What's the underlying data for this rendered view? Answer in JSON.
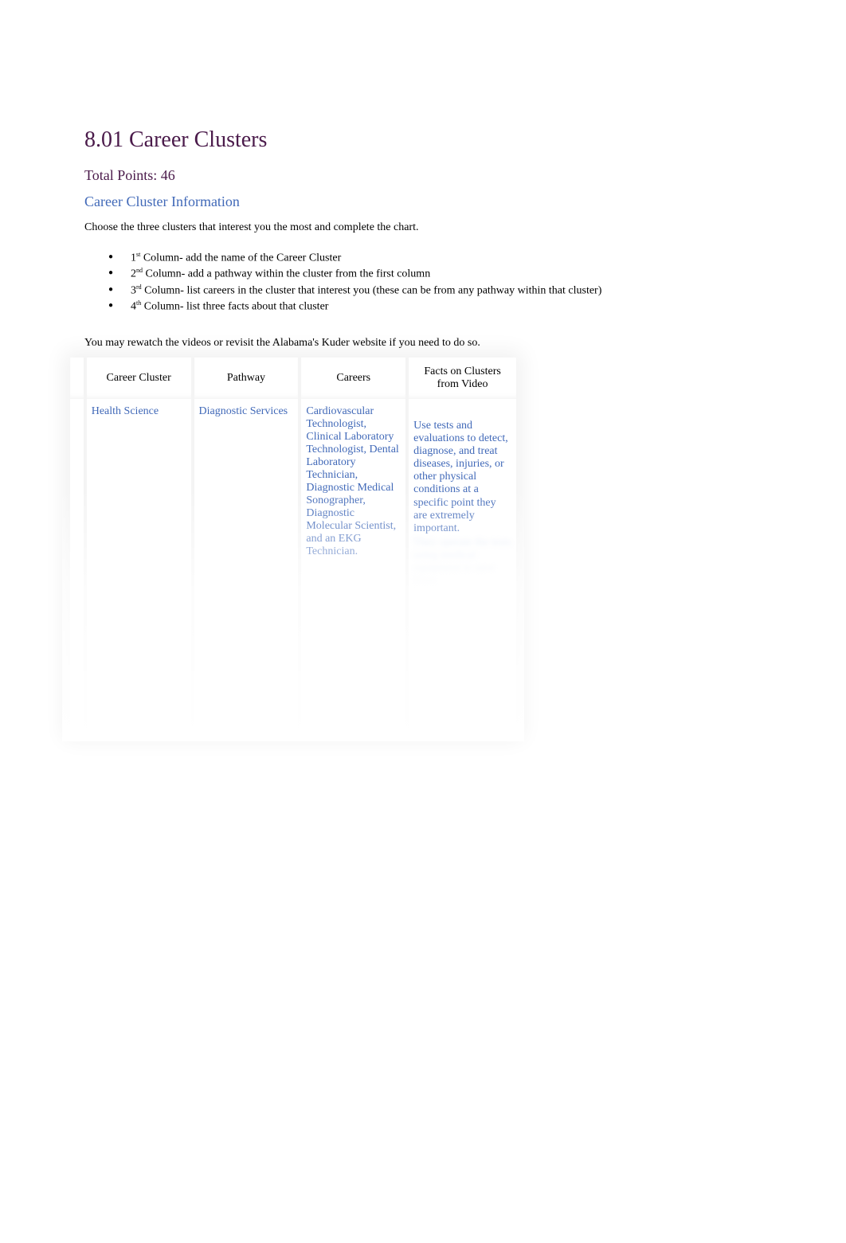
{
  "title": "8.01 Career Clusters",
  "total_points": "Total Points: 46",
  "section_heading": "Career Cluster Information",
  "instruction": "Choose the three clusters that interest you the most and complete the chart.",
  "bullets": {
    "b1_prefix": "1",
    "b1_sup": "st",
    "b1_text": " Column- add the name of the Career Cluster",
    "b2_prefix": "2",
    "b2_sup": "nd",
    "b2_text": " Column- add a pathway within the cluster from the first column",
    "b3_prefix": "3",
    "b3_sup": "rd",
    "b3_text": " Column- list careers in the cluster that interest you (these can be from any pathway within that cluster)",
    "b4_prefix": "4",
    "b4_sup": "th",
    "b4_text": " Column- list three facts about that cluster"
  },
  "note": "You may rewatch the videos or revisit the Alabama's Kuder website if you need to do so.",
  "table": {
    "headers": {
      "cluster": "Career Cluster",
      "pathway": "Pathway",
      "careers": "Careers",
      "facts": "Facts on Clusters from Video"
    },
    "row1": {
      "cluster": "Health Science",
      "pathway": "Diagnostic Services",
      "careers": "Cardiovascular Technologist, Clinical Laboratory Technologist, Dental Laboratory Technician, Diagnostic Medical Sonographer, Diagnostic Molecular Scientist, and an EKG Technician.",
      "facts_visible": "Use tests and evaluations to detect, diagnose, and treat diseases, injuries, or other physical conditions at a specific point they are extremely important.",
      "facts_blurred": "They operate the tests using medical equipment to save lives."
    }
  }
}
